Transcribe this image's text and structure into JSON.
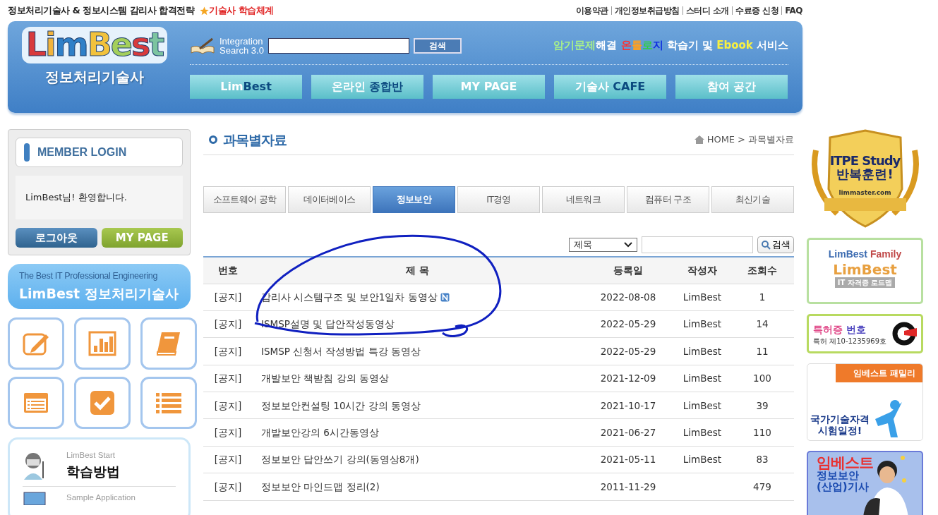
{
  "top_bar": {
    "title": "정보처리기술사 & 정보시스템 감리사  합격전략",
    "highlight_link": "기술사 학습체계",
    "util_links": [
      "이용약관",
      "개인정보취급방침",
      "스터디 소개",
      "수료증 신청",
      "FAQ"
    ]
  },
  "header": {
    "logo": {
      "letters": [
        {
          "text": "L",
          "color": "#d83a3c"
        },
        {
          "text": "i",
          "color": "#f2b43c"
        },
        {
          "text": "m",
          "color": "#2f80c8"
        },
        {
          "text": "B",
          "color": "#f2c23c"
        },
        {
          "text": "e",
          "color": "#a4cf5b"
        },
        {
          "text": "s",
          "color": "#d83a3c"
        },
        {
          "text": "t",
          "color": "#7cc4a0"
        }
      ],
      "subtitle": "정보처리기술사"
    },
    "search": {
      "label_line1": "Integration",
      "label_line2": "Search 3.0",
      "button": "검색"
    },
    "slogan": [
      {
        "text": "암기문제",
        "color": "#a8f08a"
      },
      {
        "text": "해결",
        "color": "#ffffff"
      },
      {
        "text": " 온",
        "color": "#ff3030"
      },
      {
        "text": "톨",
        "color": "#ffa020"
      },
      {
        "text": "로",
        "color": "#30d040"
      },
      {
        "text": "지",
        "color": "#1030e0"
      },
      {
        "text": " 학습기 및 ",
        "color": "#ffffff"
      },
      {
        "text": "Ebook",
        "color": "#f8f040"
      },
      {
        "text": " 서비스",
        "color": "#ffffff"
      }
    ],
    "nav": [
      {
        "label": "Lim",
        "accent": "Best"
      },
      {
        "label": "온라인 ",
        "accent": "종합반"
      },
      {
        "label": "MY PAGE"
      },
      {
        "label": "기술사 ",
        "accent": "CAFE"
      },
      {
        "label": "참여 공간"
      }
    ]
  },
  "login": {
    "title": "MEMBER LOGIN",
    "welcome": "LimBest님! 환영합니다.",
    "buttons": [
      {
        "label": "로그아웃",
        "kind": "logout"
      },
      {
        "label": "MY PAGE",
        "kind": "mypage"
      }
    ]
  },
  "promo_banner": {
    "line1": "The Best IT Professional Engineering",
    "line2": "LimBest 정보처리기술사"
  },
  "quick_icons": [
    {
      "kind": "pencil"
    },
    {
      "kind": "chart"
    },
    {
      "kind": "book"
    },
    {
      "kind": "card"
    },
    {
      "kind": "check"
    },
    {
      "kind": "list"
    }
  ],
  "start_box": [
    {
      "caption": "LimBest Start",
      "title": "학습방법",
      "kind": "person"
    },
    {
      "caption": "Sample Application",
      "kind": "monitor"
    }
  ],
  "main": {
    "title": "과목별자료",
    "breadcrumb": [
      "HOME",
      ">",
      "과목별자료"
    ],
    "tabs": [
      {
        "label": "소프트웨어 공학",
        "selected": false
      },
      {
        "label": "데이터베이스",
        "selected": false
      },
      {
        "label": "정보보안",
        "selected": true
      },
      {
        "label": "IT경영",
        "selected": false
      },
      {
        "label": "네트워크",
        "selected": false
      },
      {
        "label": "컴퓨터 구조",
        "selected": false
      },
      {
        "label": "최신기술",
        "selected": false
      }
    ],
    "search": {
      "field": "제목",
      "button": "검색"
    },
    "table": {
      "columns": [
        "번호",
        "제 목",
        "등록일",
        "작성자",
        "조회수"
      ],
      "rows": [
        {
          "number": "[공지]",
          "title": "감리사 시스템구조 및 보안1일차 동영상",
          "new": true,
          "date": "2022-08-08",
          "author": "LimBest",
          "views": "1"
        },
        {
          "number": "[공지]",
          "title": "ISMSP설명 및 답안작성동영상",
          "new": false,
          "date": "2022-05-29",
          "author": "LimBest",
          "views": "14"
        },
        {
          "number": "[공지]",
          "title": "ISMSP 신청서 작성방법 특강 동영상",
          "new": false,
          "date": "2022-05-29",
          "author": "LimBest",
          "views": "11"
        },
        {
          "number": "[공지]",
          "title": "개발보안 책받침 강의 동영상",
          "new": false,
          "date": "2021-12-09",
          "author": "LimBest",
          "views": "100"
        },
        {
          "number": "[공지]",
          "title": "정보보안컨설팅 10시간 강의 동영상",
          "new": false,
          "date": "2021-10-17",
          "author": "LimBest",
          "views": "39"
        },
        {
          "number": "[공지]",
          "title": "개발보안강의 6시간동영상",
          "new": false,
          "date": "2021-06-27",
          "author": "LimBest",
          "views": "110"
        },
        {
          "number": "[공지]",
          "title": "정보보안 답안쓰기 강의(동영상8개)",
          "new": false,
          "date": "2021-05-11",
          "author": "LimBest",
          "views": "83"
        },
        {
          "number": "[공지]",
          "title": "정보보안 마인드맵 정리(2)",
          "new": false,
          "date": "2011-11-29",
          "author": "",
          "views": "479"
        }
      ]
    }
  },
  "right_banners": {
    "badge": {
      "line1": "ITPE Study",
      "line2": "반복훈련!",
      "site": "limmaster.com"
    },
    "family": {
      "title_a": "LimBest",
      "title_b": "Family",
      "logo": "LimBest",
      "caption": "IT 자격증 로드맵"
    },
    "patent": {
      "title_a": "특허증",
      "title_b": "번호",
      "number": "특허 제10-1235969호"
    },
    "schedule": {
      "ribbon": "임베스트 패밀리",
      "line1": "국가기술자격",
      "line2": "시험일정!"
    },
    "course": {
      "line1": "임베스트",
      "line2": "정보보안",
      "line3": "(산업)기사"
    }
  }
}
